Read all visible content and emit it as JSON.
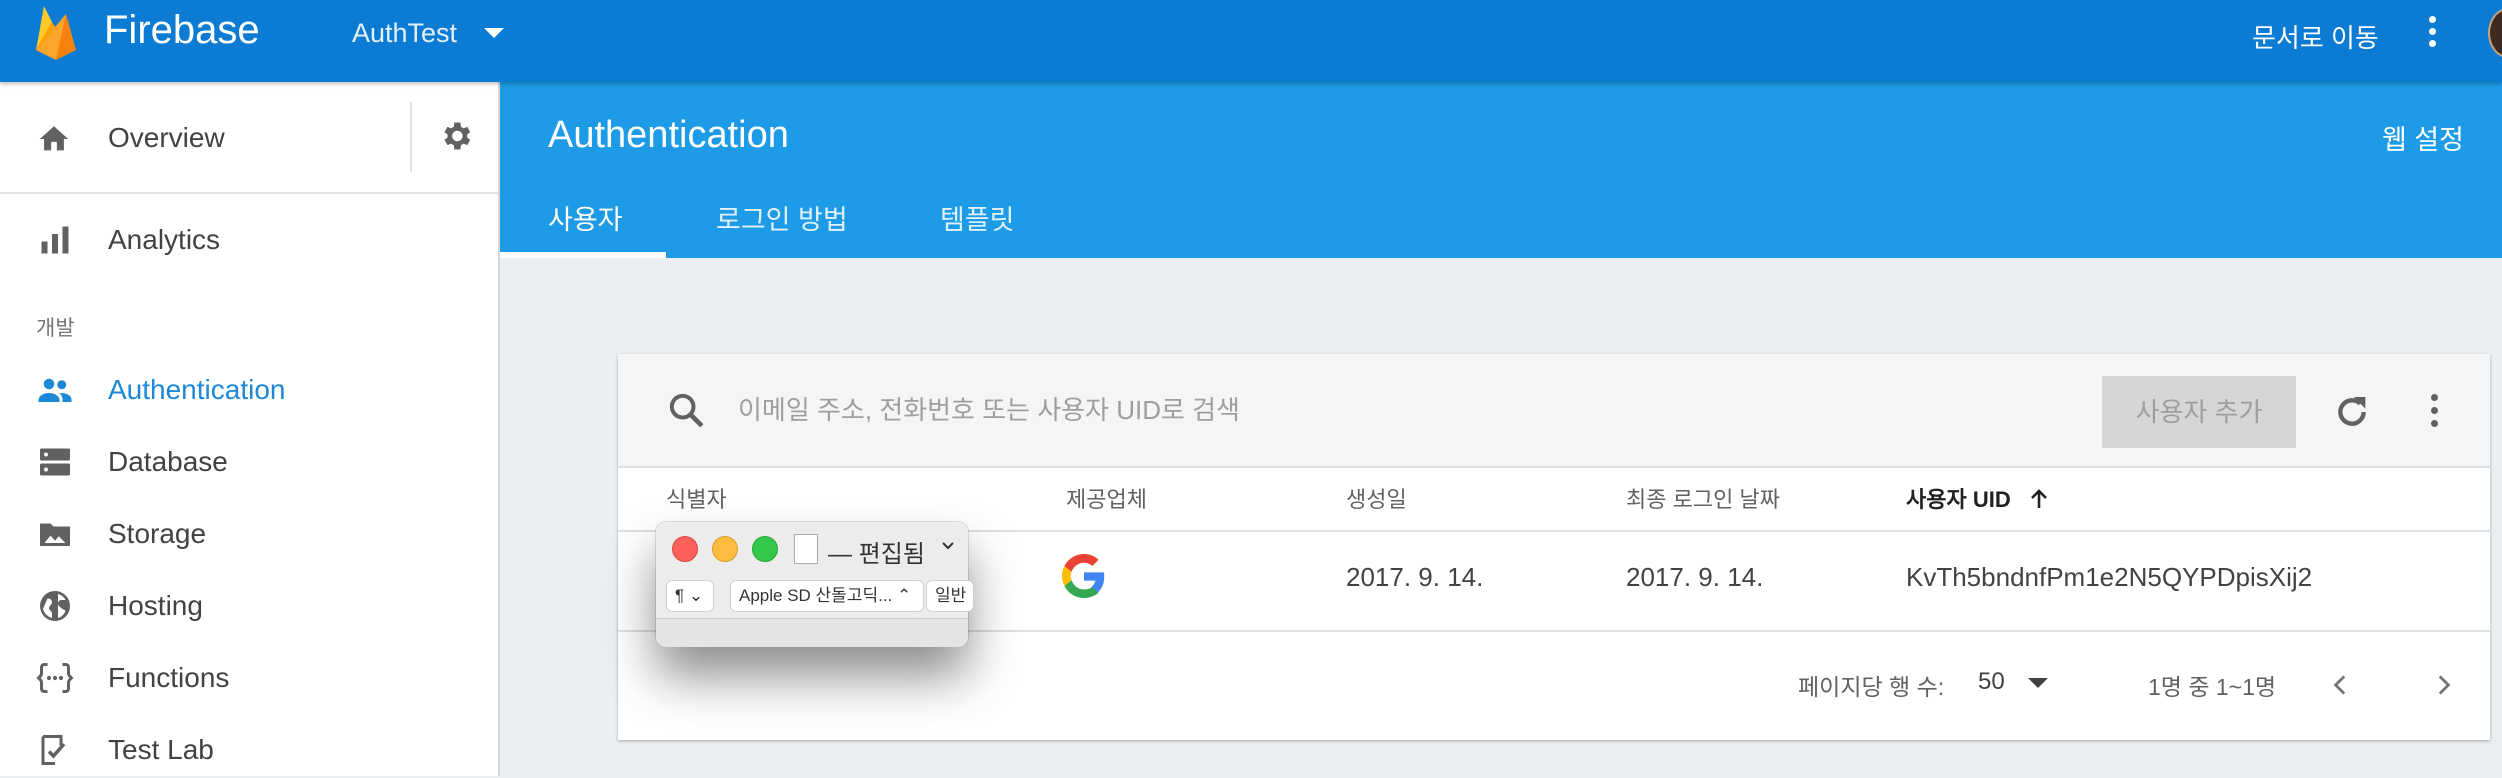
{
  "topbar": {
    "brand": "Firebase",
    "project": "AuthTest",
    "docs_link": "문서로 이동"
  },
  "sidebar": {
    "overview": "Overview",
    "analytics": "Analytics",
    "section_label": "개발",
    "items": [
      {
        "label": "Authentication",
        "icon": "people-icon",
        "active": true
      },
      {
        "label": "Database",
        "icon": "database-icon"
      },
      {
        "label": "Storage",
        "icon": "photo-icon"
      },
      {
        "label": "Hosting",
        "icon": "globe-icon"
      },
      {
        "label": "Functions",
        "icon": "functions-icon"
      },
      {
        "label": "Test Lab",
        "icon": "testlab-icon"
      }
    ]
  },
  "header": {
    "title": "Authentication",
    "web_setup": "웹 설정",
    "tabs": [
      {
        "label": "사용자",
        "active": true
      },
      {
        "label": "로그인 방법"
      },
      {
        "label": "템플릿"
      }
    ]
  },
  "users": {
    "search_placeholder": "이메일 주소, 전화번호 또는 사용자 UID로 검색",
    "add_user": "사용자 추가",
    "columns": [
      "식별자",
      "제공업체",
      "생성일",
      "최종 로그인 날짜",
      "사용자 UID"
    ],
    "rows": [
      {
        "identifier": "",
        "provider": "google-icon",
        "created": "2017. 9. 14.",
        "last_login": "2017. 9. 14.",
        "uid": "KvTh5bndnfPm1e2N5QYPDpisXij2"
      }
    ],
    "rows_per_page_label": "페이지당 행 수:",
    "rows_per_page": "50",
    "range": "1명 중 1~1명"
  },
  "mac_window": {
    "title": "— 편집됨",
    "paragraph_btn": "¶",
    "font_btn": "Apple SD 산돌고딕...",
    "style_btn": "일반"
  },
  "colors": {
    "topbar": "#0c7bd3",
    "header": "#1d9be6",
    "active_nav": "#1d88d8"
  }
}
